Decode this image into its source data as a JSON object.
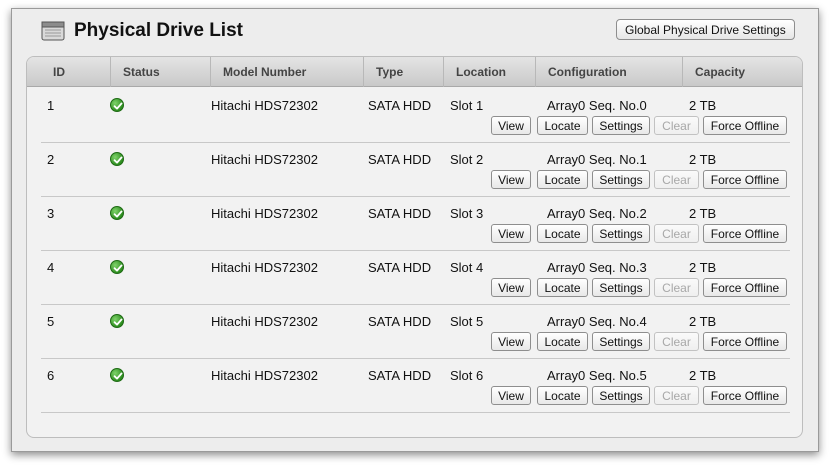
{
  "header": {
    "title": "Physical Drive List",
    "global_settings_label": "Global Physical Drive Settings"
  },
  "columns": [
    "ID",
    "Status",
    "Model Number",
    "Type",
    "Location",
    "Configuration",
    "Capacity"
  ],
  "actions": {
    "view": "View",
    "locate": "Locate",
    "settings": "Settings",
    "clear": "Clear",
    "force_offline": "Force Offline"
  },
  "drives": [
    {
      "id": "1",
      "status": "ok",
      "model": "Hitachi HDS72302",
      "type": "SATA HDD",
      "location": "Slot 1",
      "configuration": "Array0 Seq. No.0",
      "capacity": "2 TB"
    },
    {
      "id": "2",
      "status": "ok",
      "model": "Hitachi HDS72302",
      "type": "SATA HDD",
      "location": "Slot 2",
      "configuration": "Array0 Seq. No.1",
      "capacity": "2 TB"
    },
    {
      "id": "3",
      "status": "ok",
      "model": "Hitachi HDS72302",
      "type": "SATA HDD",
      "location": "Slot 3",
      "configuration": "Array0 Seq. No.2",
      "capacity": "2 TB"
    },
    {
      "id": "4",
      "status": "ok",
      "model": "Hitachi HDS72302",
      "type": "SATA HDD",
      "location": "Slot 4",
      "configuration": "Array0 Seq. No.3",
      "capacity": "2 TB"
    },
    {
      "id": "5",
      "status": "ok",
      "model": "Hitachi HDS72302",
      "type": "SATA HDD",
      "location": "Slot 5",
      "configuration": "Array0 Seq. No.4",
      "capacity": "2 TB"
    },
    {
      "id": "6",
      "status": "ok",
      "model": "Hitachi HDS72302",
      "type": "SATA HDD",
      "location": "Slot 6",
      "configuration": "Array0 Seq. No.5",
      "capacity": "2 TB"
    }
  ],
  "colors": {
    "status_ok": "#3a9b2a",
    "accent": "#111111"
  }
}
